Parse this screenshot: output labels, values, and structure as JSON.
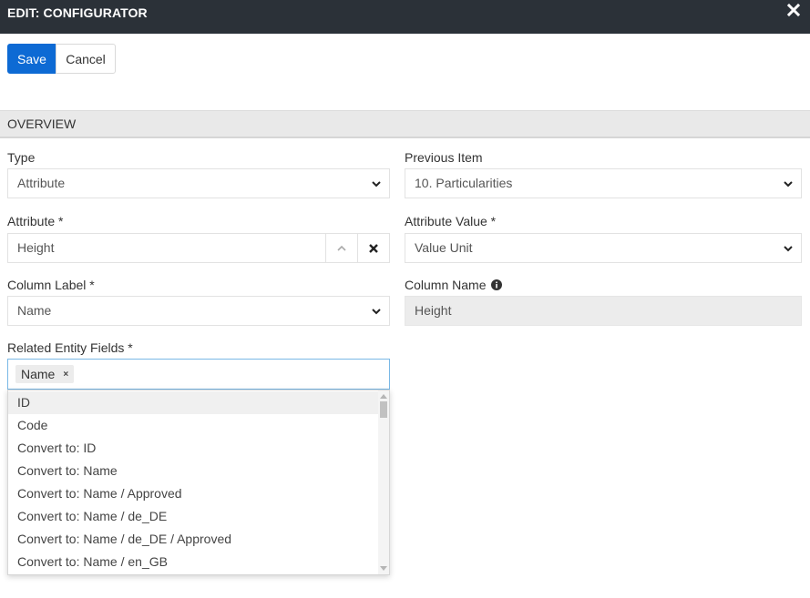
{
  "header": {
    "title": "EDIT: CONFIGURATOR",
    "close_icon": "close-icon"
  },
  "toolbar": {
    "save_label": "Save",
    "cancel_label": "Cancel"
  },
  "section": {
    "title": "OVERVIEW"
  },
  "form": {
    "type": {
      "label": "Type",
      "value": "Attribute"
    },
    "previous_item": {
      "label": "Previous Item",
      "value": "10. Particularities"
    },
    "attribute": {
      "label": "Attribute *",
      "value": "Height"
    },
    "attribute_value": {
      "label": "Attribute Value *",
      "value": "Value Unit"
    },
    "column_label": {
      "label": "Column Label *",
      "value": "Name"
    },
    "column_name": {
      "label": "Column Name",
      "value": "Height"
    },
    "related_fields": {
      "label": "Related Entity Fields *",
      "tags": [
        "Name"
      ],
      "remove_glyph": "×",
      "options": [
        "ID",
        "Code",
        "Convert to: ID",
        "Convert to: Name",
        "Convert to: Name / Approved",
        "Convert to: Name / de_DE",
        "Convert to: Name / de_DE / Approved",
        "Convert to: Name / en_GB"
      ],
      "highlighted_option": "ID"
    }
  },
  "colors": {
    "header_bg": "#2b3138",
    "primary": "#0d6ad4",
    "section_bg": "#e9e9e9",
    "focus_border": "#79b8e6"
  }
}
